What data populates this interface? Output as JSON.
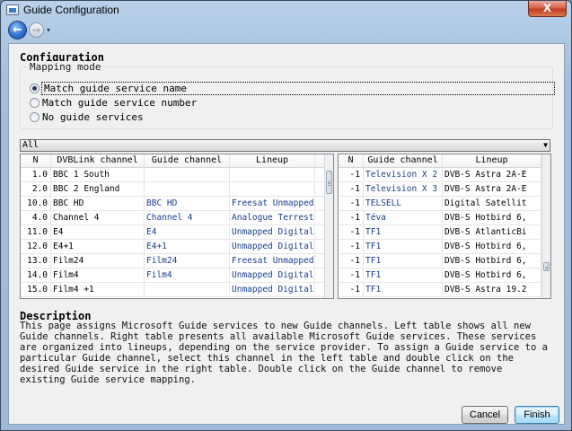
{
  "window": {
    "title": "Guide Configuration",
    "close_symbol": "X"
  },
  "nav": {
    "back_icon": "←",
    "forward_icon": "→",
    "dropdown_icon": "▾"
  },
  "configuration": {
    "heading": "Configuration",
    "mapping_mode": {
      "legend": "Mapping mode",
      "options": [
        {
          "label": "Match guide service name",
          "checked": true
        },
        {
          "label": "Match guide service number",
          "checked": false
        },
        {
          "label": "No guide services",
          "checked": false
        }
      ]
    },
    "filter": {
      "selected": "All"
    }
  },
  "left_table": {
    "columns": [
      "N",
      "DVBLink channel",
      "Guide channel",
      "Lineup"
    ],
    "rows": [
      [
        "1.0",
        "BBC 1 South",
        "",
        ""
      ],
      [
        "2.0",
        "BBC 2 England",
        "",
        ""
      ],
      [
        "10.0",
        "BBC HD",
        "BBC HD",
        "Freesat Unmapped"
      ],
      [
        "4.0",
        "Channel 4",
        "Channel 4",
        "Analogue Terrest"
      ],
      [
        "11.0",
        "E4",
        "E4",
        "Unmapped Digital"
      ],
      [
        "12.0",
        "E4+1",
        "E4+1",
        "Unmapped Digital"
      ],
      [
        "13.0",
        "Film24",
        "Film24",
        "Freesat Unmapped"
      ],
      [
        "14.0",
        "Film4",
        "Film4",
        "Unmapped Digital"
      ],
      [
        "15.0",
        "Film4 +1",
        "",
        "Unmapped Digital"
      ]
    ]
  },
  "right_table": {
    "columns": [
      "N",
      "Guide channel",
      "Lineup"
    ],
    "rows": [
      [
        "-1",
        "Television X 2",
        "DVB-S Astra 2A-E"
      ],
      [
        "-1",
        "Television X 3",
        "DVB-S Astra 2A-E"
      ],
      [
        "-1",
        "TELSELL",
        "Digital Satellit"
      ],
      [
        "-1",
        "Téva",
        "DVB-S Hotbird 6,"
      ],
      [
        "-1",
        "TF1",
        "DVB-S AtlanticBi"
      ],
      [
        "-1",
        "TF1",
        "DVB-S Hotbird 6,"
      ],
      [
        "-1",
        "TF1",
        "DVB-S Hotbird 6,"
      ],
      [
        "-1",
        "TF1",
        "DVB-S Hotbird 6,"
      ],
      [
        "-1",
        "TF1",
        "DVB-S Astra 19.2"
      ]
    ]
  },
  "description": {
    "heading": "Description",
    "text": "This page assigns Microsoft Guide services to new Guide channels. Left table shows all new Guide channels. Right table presents all available Microsoft Guide services. These services are organized into lineups, depending on the service provider. To assign a Guide service to a particular Guide channel, select this channel in the left table and double click on the desired Guide service in the right table. Double click on the Guide channel to remove existing Guide service mapping."
  },
  "buttons": {
    "cancel": "Cancel",
    "finish": "Finish"
  }
}
